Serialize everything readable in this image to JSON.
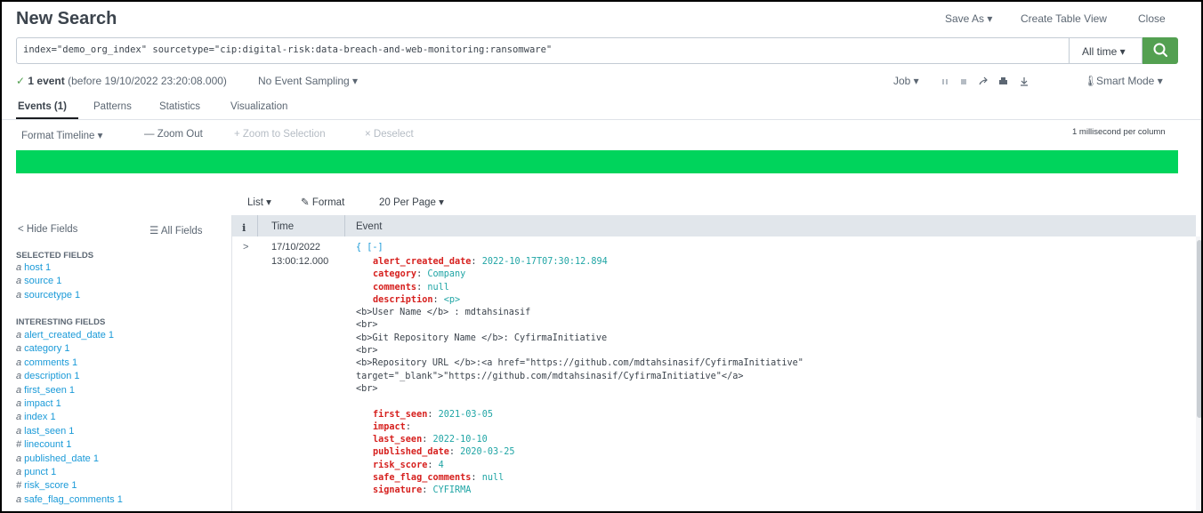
{
  "header": {
    "title": "New Search",
    "save_as": "Save As ▾",
    "create_table_view": "Create Table View",
    "close": "Close"
  },
  "search": {
    "query": "index=\"demo_org_index\" sourcetype=\"cip:digital-risk:data-breach-and-web-monitoring:ransomware\"",
    "time_range": "All time ▾"
  },
  "status": {
    "check": "✓",
    "events": "1 event",
    "before": " (before 19/10/2022 23:20:08.000)",
    "sampling": "No Event Sampling ▾",
    "job": "Job ▾",
    "mode": "Smart Mode ▾"
  },
  "tabs": [
    "Events (1)",
    "Patterns",
    "Statistics",
    "Visualization"
  ],
  "timeline_toolbar": {
    "format_timeline": "Format Timeline ▾",
    "zoom_out": "— Zoom Out",
    "zoom_selection": "+ Zoom to Selection",
    "deselect": "× Deselect",
    "scale": "1 millisecond per column"
  },
  "colors": {
    "accent_green": "#53a051",
    "timeline_green": "#00d45c",
    "key_red": "#d6201e",
    "value_teal": "#20a5a5",
    "link_blue": "#1a9ad8"
  },
  "list_options": {
    "list": "List ▾",
    "format": "Format",
    "per_page": "20 Per Page ▾"
  },
  "sidebar": {
    "hide_fields": "< Hide Fields",
    "all_fields": "All Fields",
    "selected_title": "SELECTED FIELDS",
    "selected": [
      {
        "type": "a",
        "name": "host",
        "count": "1"
      },
      {
        "type": "a",
        "name": "source",
        "count": "1"
      },
      {
        "type": "a",
        "name": "sourcetype",
        "count": "1"
      }
    ],
    "interesting_title": "INTERESTING FIELDS",
    "interesting": [
      {
        "type": "a",
        "name": "alert_created_date",
        "count": "1"
      },
      {
        "type": "a",
        "name": "category",
        "count": "1"
      },
      {
        "type": "a",
        "name": "comments",
        "count": "1"
      },
      {
        "type": "a",
        "name": "description",
        "count": "1"
      },
      {
        "type": "a",
        "name": "first_seen",
        "count": "1"
      },
      {
        "type": "a",
        "name": "impact",
        "count": "1"
      },
      {
        "type": "a",
        "name": "index",
        "count": "1"
      },
      {
        "type": "a",
        "name": "last_seen",
        "count": "1"
      },
      {
        "type": "#",
        "name": "linecount",
        "count": "1"
      },
      {
        "type": "a",
        "name": "published_date",
        "count": "1"
      },
      {
        "type": "a",
        "name": "punct",
        "count": "1"
      },
      {
        "type": "#",
        "name": "risk_score",
        "count": "1"
      },
      {
        "type": "a",
        "name": "safe_flag_comments",
        "count": "1"
      }
    ]
  },
  "table": {
    "col_i": "i",
    "col_time": "Time",
    "col_event": "Event",
    "expand": ">",
    "date": "17/10/2022",
    "time": "13:00:12.000",
    "brace": "{ [-]",
    "lines": [
      {
        "kind": "kv",
        "key": "alert_created_date",
        "value": "2022-10-17T07:30:12.894"
      },
      {
        "kind": "kv",
        "key": "category",
        "value": "Company"
      },
      {
        "kind": "kv",
        "key": "comments",
        "value": "null"
      },
      {
        "kind": "kv",
        "key": "description",
        "value": "<p>"
      },
      {
        "kind": "raw",
        "text": "<b>User Name </b> : mdtahsinasif"
      },
      {
        "kind": "raw",
        "text": "<br>"
      },
      {
        "kind": "raw",
        "text": "<b>Git Repository Name </b>: CyfirmaInitiative"
      },
      {
        "kind": "raw",
        "text": "<br>"
      },
      {
        "kind": "raw",
        "text": "<b>Repository URL </b>:<a href=\"https://github.com/mdtahsinasif/CyfirmaInitiative\""
      },
      {
        "kind": "raw",
        "text": "target=\"_blank\">\"https://github.com/mdtahsinasif/CyfirmaInitiative\"</a>"
      },
      {
        "kind": "raw",
        "text": "<br>"
      },
      {
        "kind": "blank",
        "text": ""
      },
      {
        "kind": "kv",
        "key": "first_seen",
        "value": "2021-03-05"
      },
      {
        "kind": "kv",
        "key": "impact",
        "value": ""
      },
      {
        "kind": "kv",
        "key": "last_seen",
        "value": "2022-10-10"
      },
      {
        "kind": "kv",
        "key": "published_date",
        "value": "2020-03-25"
      },
      {
        "kind": "kv",
        "key": "risk_score",
        "value": "4"
      },
      {
        "kind": "kv",
        "key": "safe_flag_comments",
        "value": "null"
      },
      {
        "kind": "kv",
        "key": "signature",
        "value": "CYFIRMA"
      }
    ]
  }
}
